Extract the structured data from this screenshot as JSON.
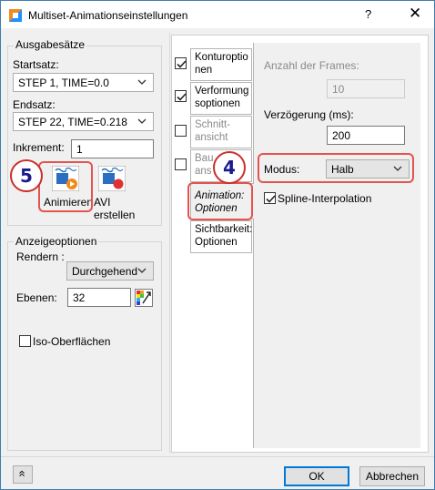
{
  "window": {
    "title": "Multiset-Animationseinstellungen",
    "help": "?",
    "close": "✕"
  },
  "ausgabe": {
    "group_title": "Ausgabesätze",
    "startsatz_label": "Startsatz:",
    "startsatz_value": "STEP 1, TIME=0.0",
    "endsatz_label": "Endsatz:",
    "endsatz_value": "STEP 22, TIME=0.218",
    "inkrement_label": "Inkrement:",
    "inkrement_value": "1",
    "animieren_label": "Animieren",
    "avi_line1": "AVI",
    "avi_line2": "erstellen"
  },
  "anzeige": {
    "group_title": "Anzeigeoptionen",
    "rendern_label": "Rendern :",
    "rendern_value": "Durchgehend",
    "ebenen_label": "Ebenen:",
    "ebenen_value": "32",
    "iso_label": "Iso-Oberflächen"
  },
  "tabs": [
    {
      "line1": "Konturoptio",
      "line2": "nen",
      "checked": true
    },
    {
      "line1": "Verformung",
      "line2": "soptionen",
      "checked": true
    },
    {
      "line1": "Schnitt-",
      "line2": "ansicht",
      "checked": false
    },
    {
      "line1": "Bau",
      "line2": "ans",
      "checked": false
    },
    {
      "line1": "Animation:",
      "line2": "Optionen"
    },
    {
      "line1": "Sichtbarkeit:",
      "line2": "Optionen"
    }
  ],
  "animation_options": {
    "frames_label": "Anzahl der Frames:",
    "frames_value": "10",
    "delay_label": "Verzögerung (ms):",
    "delay_value": "200",
    "mode_label": "Modus:",
    "mode_value": "Halb",
    "spline_label": "Spline-Interpolation"
  },
  "badges": {
    "four": "4",
    "five": "5"
  },
  "footer": {
    "ok": "OK",
    "cancel": "Abbrechen",
    "collapse": "«"
  },
  "colors": {
    "highlight": "#e4544f",
    "accent": "#0078d7",
    "badge_text": "#1a1a8f"
  }
}
